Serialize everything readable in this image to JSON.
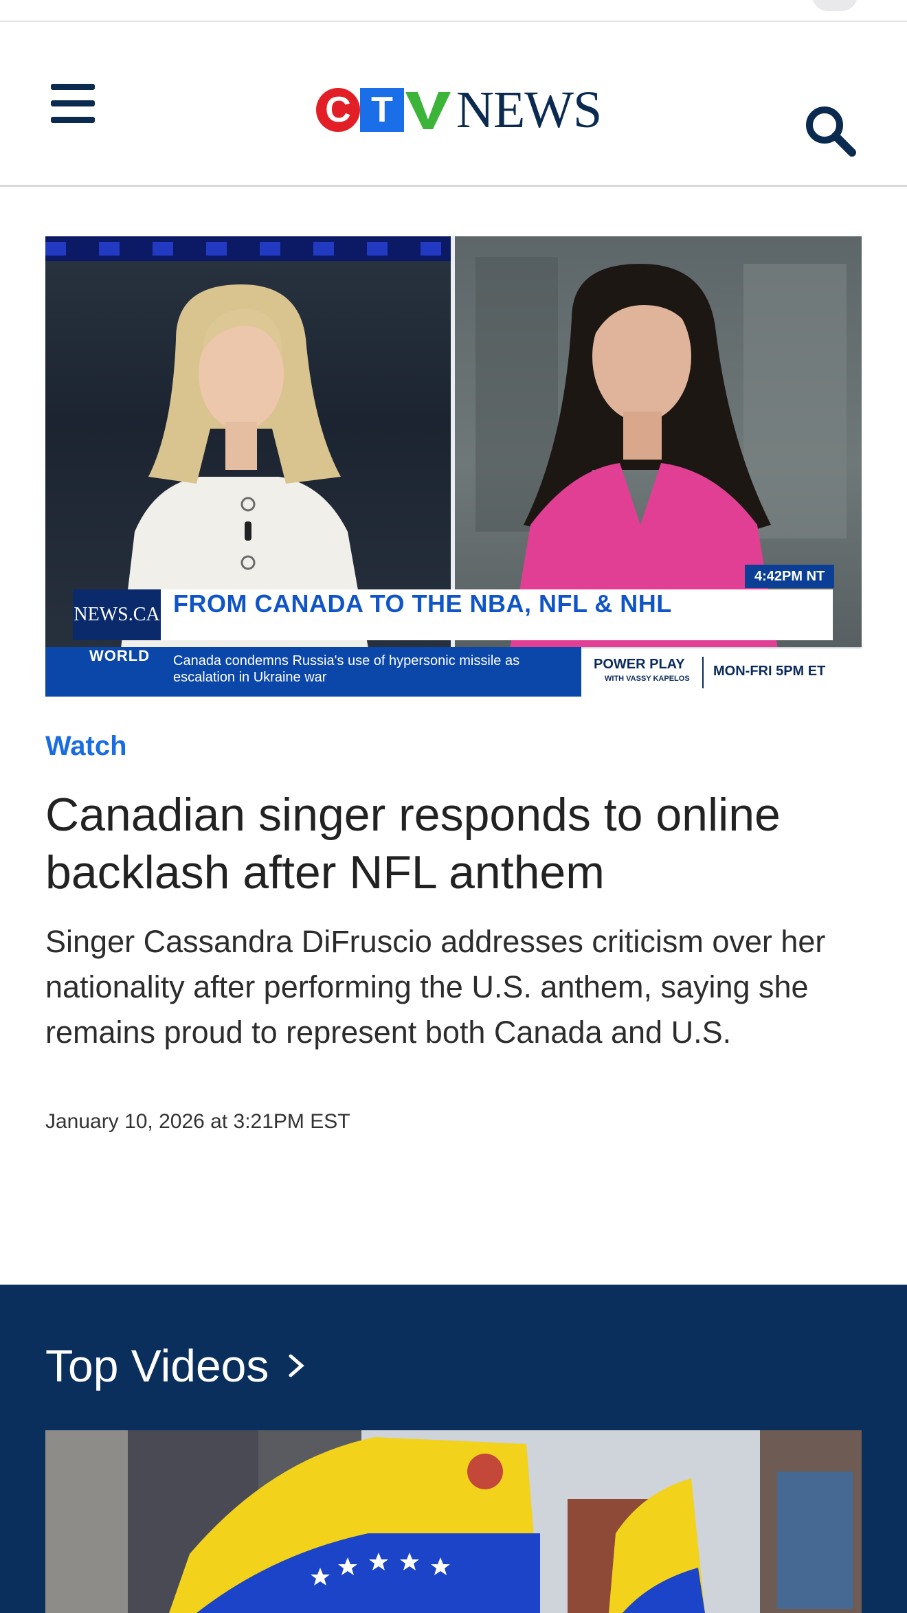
{
  "header": {
    "logo": {
      "c": "C",
      "t": "T",
      "v": "V",
      "word": "NEWS"
    },
    "menu_icon": "hamburger-menu-icon",
    "search_icon": "search-icon"
  },
  "hero_video": {
    "lower_third_brand": "NEWS.CA",
    "lower_third_headline": "FROM CANADA TO THE NBA, NFL & NHL",
    "time_tag": "4:42PM NT",
    "ticker_category": "WORLD",
    "ticker_text": "Canada condemns Russia's use of hypersonic missile as escalation in Ukraine war",
    "promo_show": "POWER PLAY",
    "promo_host": "WITH VASSY KAPELOS",
    "promo_schedule": "MON-FRI 5PM ET"
  },
  "article": {
    "kicker": "Watch",
    "title": "Canadian singer responds to online backlash after NFL anthem",
    "description": "Singer Cassandra DiFruscio addresses criticism over her nationality after performing the U.S. anthem, saying she remains proud to represent both Canada and U.S.",
    "date": "January 10, 2026 at 3:21PM EST"
  },
  "top_videos": {
    "title": "Top Videos"
  },
  "colors": {
    "brand_navy": "#0a2a4f",
    "link_blue": "#1a6de0",
    "ctv_red": "#e21f26",
    "ctv_blue": "#1a6fe8",
    "ctv_green": "#3cb43a",
    "section_bg": "#0b2f5c"
  }
}
